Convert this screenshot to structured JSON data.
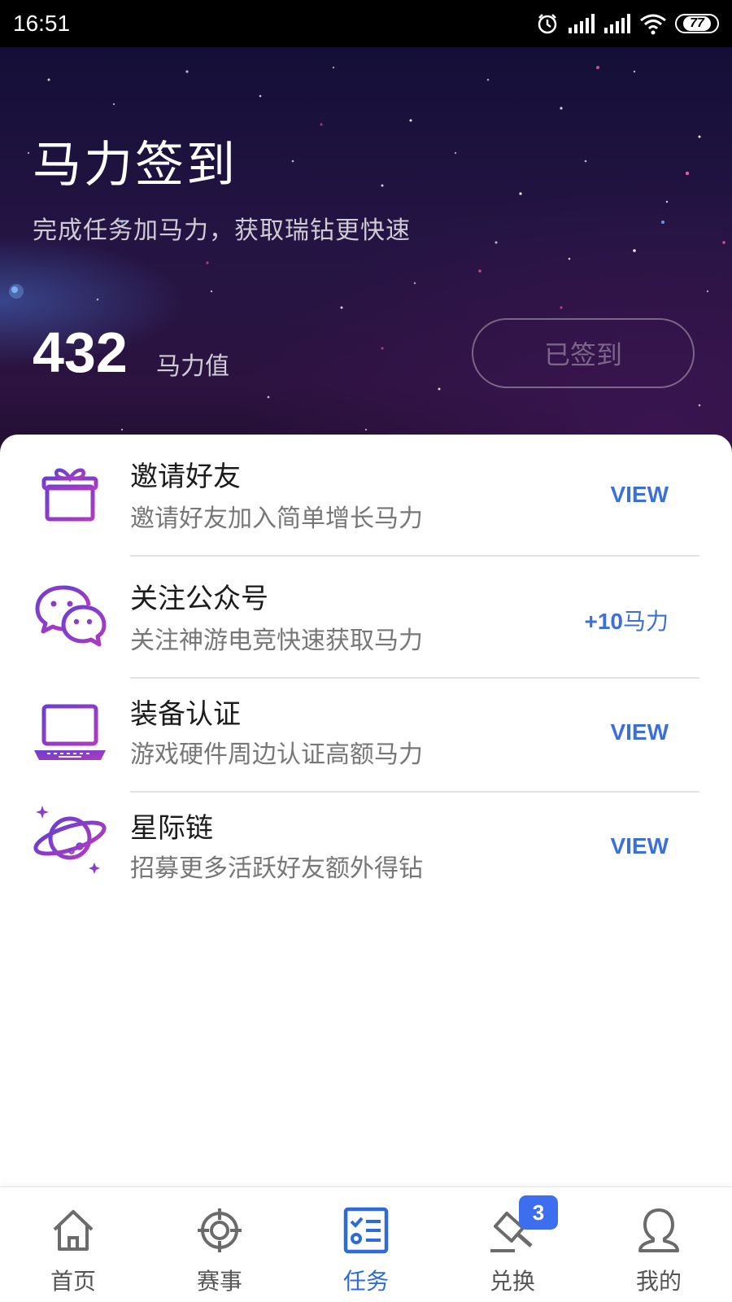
{
  "status_bar": {
    "time": "16:51",
    "battery": "77"
  },
  "hero": {
    "title": "马力签到",
    "subtitle": "完成任务加马力，获取瑞钻更快速",
    "points": "432",
    "points_unit": "马力值",
    "sign_button": "已签到"
  },
  "tasks": [
    {
      "title": "邀请好友",
      "desc": "邀请好友加入简单增长马力",
      "action": "VIEW",
      "icon": "gift-icon"
    },
    {
      "title": "关注公众号",
      "desc": "关注神游电竞快速获取马力",
      "action_bold": "+10",
      "action_rest": "马力",
      "icon": "wechat-icon"
    },
    {
      "title": "装备认证",
      "desc": "游戏硬件周边认证高额马力",
      "action": "VIEW",
      "icon": "laptop-icon"
    },
    {
      "title": "星际链",
      "desc": "招募更多活跃好友额外得钻",
      "action": "VIEW",
      "icon": "planet-icon"
    }
  ],
  "nav": {
    "items": [
      {
        "label": "首页",
        "icon": "home-icon"
      },
      {
        "label": "赛事",
        "icon": "target-icon"
      },
      {
        "label": "任务",
        "icon": "tasks-icon",
        "active": true
      },
      {
        "label": "兑换",
        "icon": "exchange-icon",
        "badge": "3"
      },
      {
        "label": "我的",
        "icon": "profile-icon"
      }
    ]
  },
  "colors": {
    "accent": "#3d6fd8",
    "icon_gradient_start": "#6a3fd0",
    "icon_gradient_end": "#b03ac0"
  }
}
